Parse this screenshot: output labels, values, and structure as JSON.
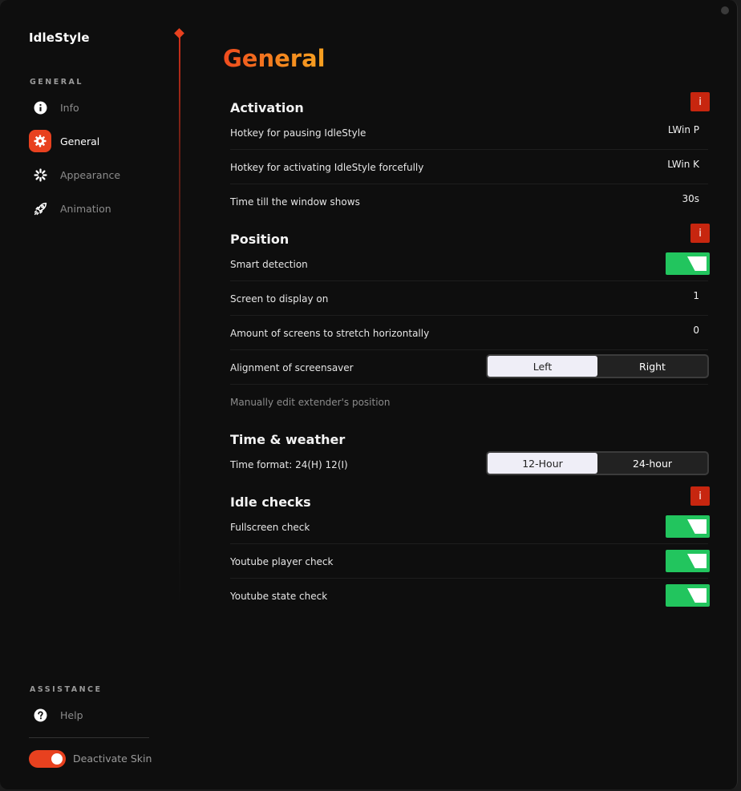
{
  "app": {
    "name": "IdleStyle"
  },
  "sidebar": {
    "general_label": "GENERAL",
    "items": [
      {
        "label": "Info",
        "icon": "info-icon"
      },
      {
        "label": "General",
        "icon": "gear-icon",
        "active": true
      },
      {
        "label": "Appearance",
        "icon": "loader-icon"
      },
      {
        "label": "Animation",
        "icon": "rocket-icon"
      }
    ],
    "assistance_label": "ASSISTANCE",
    "help_label": "Help",
    "deactivate_label": "Deactivate Skin"
  },
  "page": {
    "title": "General"
  },
  "activation": {
    "title": "Activation",
    "rows": [
      {
        "label": "Hotkey for pausing IdleStyle",
        "value": "LWin P"
      },
      {
        "label": "Hotkey for activating IdleStyle forcefully",
        "value": "LWin K"
      },
      {
        "label": "Time till the window shows",
        "value": "30s"
      }
    ]
  },
  "position": {
    "title": "Position",
    "smart_detection": {
      "label": "Smart detection",
      "on": true
    },
    "screen_display": {
      "label": "Screen to display on",
      "value": "1"
    },
    "stretch": {
      "label": "Amount of screens to stretch horizontally",
      "value": "0"
    },
    "alignment": {
      "label": "Alignment of screensaver",
      "options": [
        "Left",
        "Right"
      ],
      "selected": "Left"
    },
    "manual_edit": {
      "label": "Manually edit extender's position"
    }
  },
  "time_weather": {
    "title": "Time & weather",
    "format": {
      "label": "Time format: 24(H) 12(I)",
      "options": [
        "12-Hour",
        "24-hour"
      ],
      "selected": "12-Hour"
    }
  },
  "idle_checks": {
    "title": "Idle checks",
    "rows": [
      {
        "label": "Fullscreen check",
        "on": true
      },
      {
        "label": "Youtube player check",
        "on": true
      },
      {
        "label": "Youtube state check",
        "on": true
      }
    ]
  },
  "info_badge": "i",
  "colors": {
    "accent": "#e8411f",
    "toggle_on": "#22c55e",
    "background": "#0e0e0e"
  }
}
